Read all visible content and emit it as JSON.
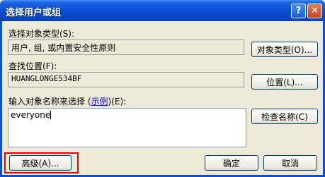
{
  "window": {
    "title": "选择用户或组",
    "help_label": "?",
    "close_label": "✕"
  },
  "object_types": {
    "label": "选择对象类型(S):",
    "value": "用户, 组, 或内置安全性原则",
    "button": "对象类型(O)..."
  },
  "location": {
    "label": "查找位置(F):",
    "value": "HUANGLONGE534BF",
    "button": "位置(L)..."
  },
  "names": {
    "label_prefix": "输入对象名称来选择 (",
    "label_link": "示例",
    "label_suffix": ")(E):",
    "value": "everyone",
    "check_button": "检查名称(C)"
  },
  "footer": {
    "advanced_button": "高级(A)...",
    "ok_button": "确定",
    "cancel_button": "取消"
  },
  "colors": {
    "highlight": "#e8000b",
    "titlebar": "#0a4fd4"
  }
}
